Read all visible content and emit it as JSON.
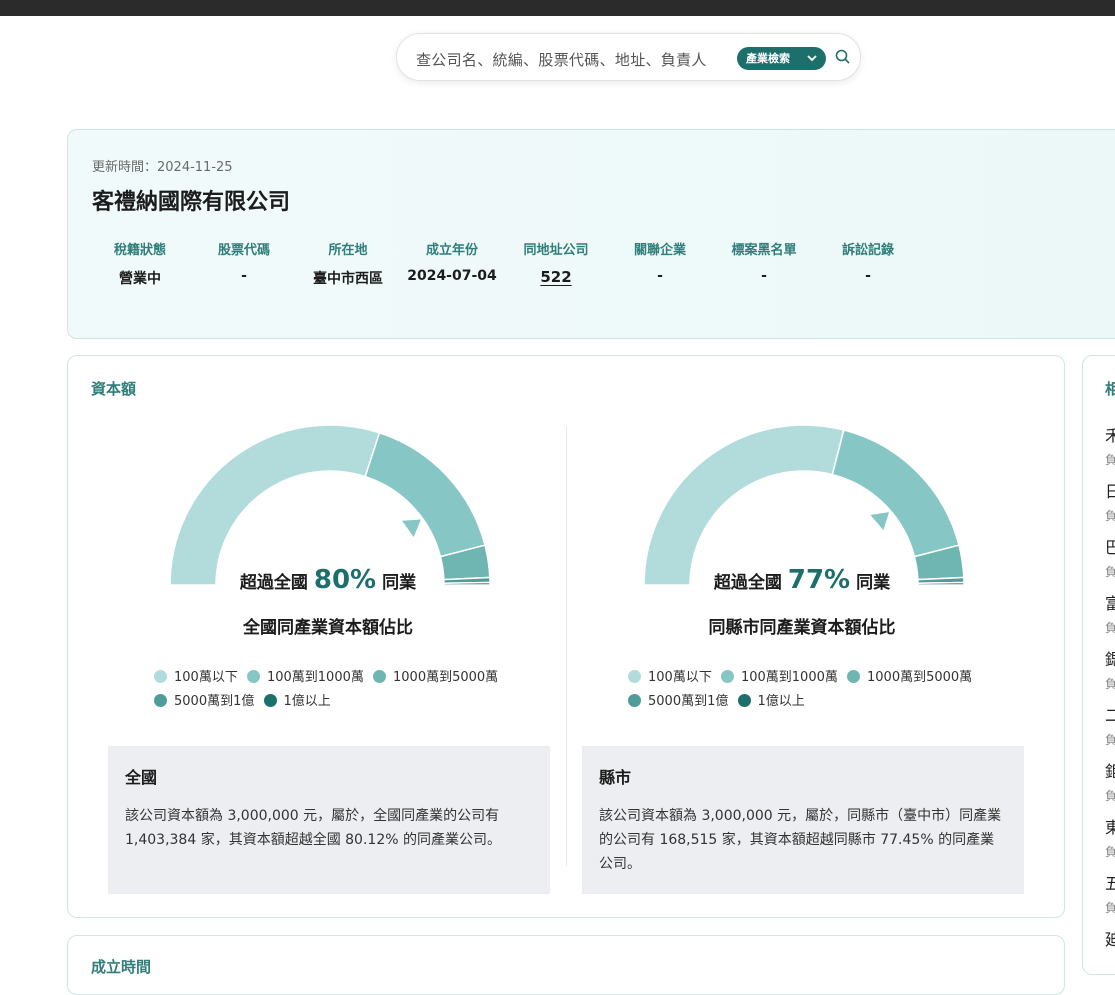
{
  "search": {
    "placeholder": "查公司名、統編、股票代碼、地址、負責人",
    "mode_label": "產業檢索",
    "chevron_icon": "chevron-down-icon",
    "search_icon": "search-icon"
  },
  "company": {
    "updated": "更新時間：2024-11-25",
    "name": "客禮納國際有限公司",
    "fields": [
      {
        "label": "稅籍狀態",
        "value": "營業中"
      },
      {
        "label": "股票代碼",
        "value": "-"
      },
      {
        "label": "所在地",
        "value": "臺中市西區"
      },
      {
        "label": "成立年份",
        "value": "2024-07-04"
      },
      {
        "label": "同地址公司",
        "value": "522"
      },
      {
        "label": "關聯企業",
        "value": "-"
      },
      {
        "label": "標案黑名單",
        "value": "-"
      },
      {
        "label": "訴訟記錄",
        "value": "-"
      }
    ]
  },
  "capital": {
    "title": "資本額",
    "national": {
      "prefix": "超過全國",
      "percent": "80%",
      "suffix": "同業",
      "subtitle": "全國同產業資本額佔比",
      "percentile": 80.12,
      "note_title": "全國",
      "note_text": "該公司資本額為 3,000,000 元，屬於，全國同產業的公司有 1,403,384 家，其資本額超越全國 80.12% 的同產業公司。"
    },
    "county": {
      "prefix": "超過全國",
      "percent": "77%",
      "suffix": "同業",
      "subtitle": "同縣市同產業資本額佔比",
      "percentile": 77.45,
      "note_title": "縣市",
      "note_text": "該公司資本額為 3,000,000 元，屬於，同縣市（臺中市）同產業的公司有 168,515 家，其資本額超越同縣市 77.45% 的同產業公司。"
    },
    "legend": [
      {
        "label": "100萬以下",
        "color": "#b2dcdc"
      },
      {
        "label": "100萬到1000萬",
        "color": "#86c7c6"
      },
      {
        "label": "1000萬到5000萬",
        "color": "#6fb6b3"
      },
      {
        "label": "5000萬到1億",
        "color": "#4f9d9a"
      },
      {
        "label": "1億以上",
        "color": "#1d6f6b"
      }
    ]
  },
  "chart_data": [
    {
      "type": "pie",
      "title": "全國同產業資本額佔比",
      "categories": [
        "100萬以下",
        "100萬到1000萬",
        "1000萬到5000萬",
        "5000萬到1億",
        "1億以上"
      ],
      "values": [
        60,
        32,
        6.5,
        1,
        0.5
      ],
      "marker_percentile": 80.12
    },
    {
      "type": "pie",
      "title": "同縣市同產業資本額佔比",
      "categories": [
        "100萬以下",
        "100萬到1000萬",
        "1000萬到5000萬",
        "5000萬到1億",
        "1億以上"
      ],
      "values": [
        58,
        34,
        6.5,
        1,
        0.5
      ],
      "marker_percentile": 77.45
    }
  ],
  "sidebar": {
    "title_partial": "相",
    "items": [
      {
        "name": "禾",
        "sub": "負"
      },
      {
        "name": "日",
        "sub": "負"
      },
      {
        "name": "巴",
        "sub": "負"
      },
      {
        "name": "富",
        "sub": "負"
      },
      {
        "name": "鍶",
        "sub": "負"
      },
      {
        "name": "二",
        "sub": "負"
      },
      {
        "name": "鉅",
        "sub": "負"
      },
      {
        "name": "東",
        "sub": "負"
      },
      {
        "name": "五",
        "sub": "負"
      },
      {
        "name": "廸",
        "sub": "負"
      }
    ]
  },
  "next_section": {
    "title_partial": "成立時間"
  }
}
